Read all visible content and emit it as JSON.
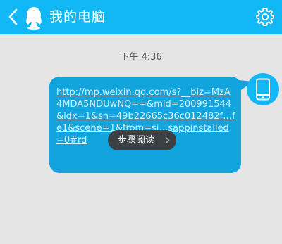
{
  "header": {
    "title": "我的电脑",
    "back_icon": "chevron-left-icon",
    "logo_icon": "qq-penguin-icon",
    "settings_icon": "gear-icon",
    "background_color": "#12b7f5"
  },
  "chat": {
    "timestamp": "下午 4:36",
    "message": {
      "link_text": "http://mp.weixin.qq.com/s?__biz=MzA4MDA5NDUwNQ==&mid=200991544&idx=1&sn=49b22665c36c012482f…fe1&scene=1&from=si…sappinstalled=0#rd",
      "bubble_color": "#12a4dd"
    },
    "sender_avatar_icon": "phone-icon",
    "step_reading_label": "步骤阅读",
    "step_reading_chevron_icon": "chevron-right-icon"
  },
  "colors": {
    "page_background": "#e5e5e5",
    "pill_background": "#3d3d3d"
  }
}
